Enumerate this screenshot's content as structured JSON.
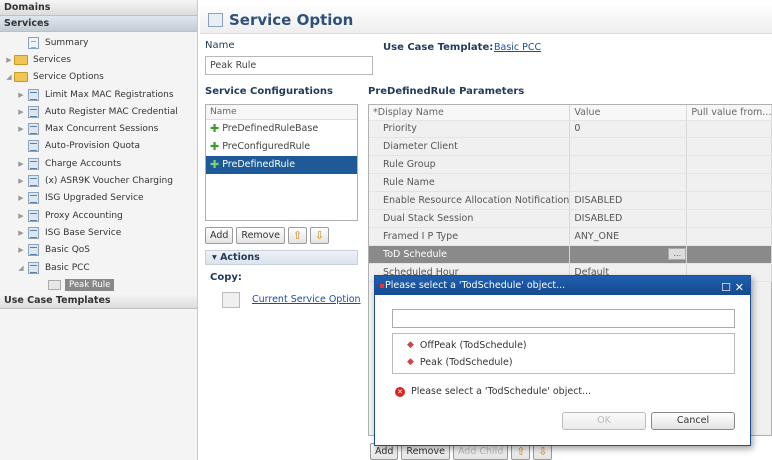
{
  "sidebar": {
    "domains_label": "Domains",
    "services_label": "Services",
    "use_case_templates_label": "Use Case Templates",
    "tree": [
      {
        "label": "Summary"
      },
      {
        "label": "Services"
      },
      {
        "label": "Service Options"
      },
      {
        "label": "Limit Max MAC Registrations"
      },
      {
        "label": "Auto Register MAC Credential"
      },
      {
        "label": "Max Concurrent Sessions"
      },
      {
        "label": "Auto-Provision Quota"
      },
      {
        "label": "Charge Accounts"
      },
      {
        "label": "(x) ASR9K Voucher Charging"
      },
      {
        "label": "ISG Upgraded Service"
      },
      {
        "label": "Proxy Accounting"
      },
      {
        "label": "ISG Base Service"
      },
      {
        "label": "Basic QoS"
      },
      {
        "label": "Basic PCC"
      },
      {
        "label": "Peak Rule"
      }
    ]
  },
  "main": {
    "title": "Service Option",
    "name_label": "Name",
    "name_value": "Peak Rule",
    "use_case_template_label": "Use Case Template:",
    "use_case_template_link": "Basic PCC",
    "service_configurations_label": "Service Configurations",
    "params_label": "PreDefinedRule Parameters",
    "cfg_header": "Name",
    "configurations": [
      {
        "label": "PreDefinedRuleBase"
      },
      {
        "label": "PreConfiguredRule"
      },
      {
        "label": "PreDefinedRule"
      }
    ],
    "cfg_buttons": {
      "add": "Add",
      "remove": "Remove"
    },
    "actions_label": "Actions",
    "copy_label": "Copy:",
    "copy_link": "Current Service Option",
    "params_headers": [
      "*Display Name",
      "Value",
      "Pull value from..."
    ],
    "params": [
      {
        "name": "Priority",
        "value": "0"
      },
      {
        "name": "Diameter Client",
        "value": ""
      },
      {
        "name": "Rule Group",
        "value": ""
      },
      {
        "name": "Rule Name",
        "value": ""
      },
      {
        "name": "Enable Resource Allocation Notification",
        "value": "DISABLED"
      },
      {
        "name": "Dual Stack Session",
        "value": "DISABLED"
      },
      {
        "name": "Framed I P Type",
        "value": "ANY_ONE"
      },
      {
        "name": "ToD Schedule",
        "value": ""
      },
      {
        "name": "Scheduled Hour",
        "value": "Default"
      }
    ],
    "params_buttons": {
      "add": "Add",
      "remove": "Remove",
      "add_child": "Add Child"
    }
  },
  "dialog": {
    "title": "Please select a 'TodSchedule' object...",
    "search_value": "",
    "options": [
      "OffPeak (TodSchedule)",
      "Peak (TodSchedule)"
    ],
    "message": "Please select a 'TodSchedule' object...",
    "ok_label": "OK",
    "cancel_label": "Cancel"
  }
}
